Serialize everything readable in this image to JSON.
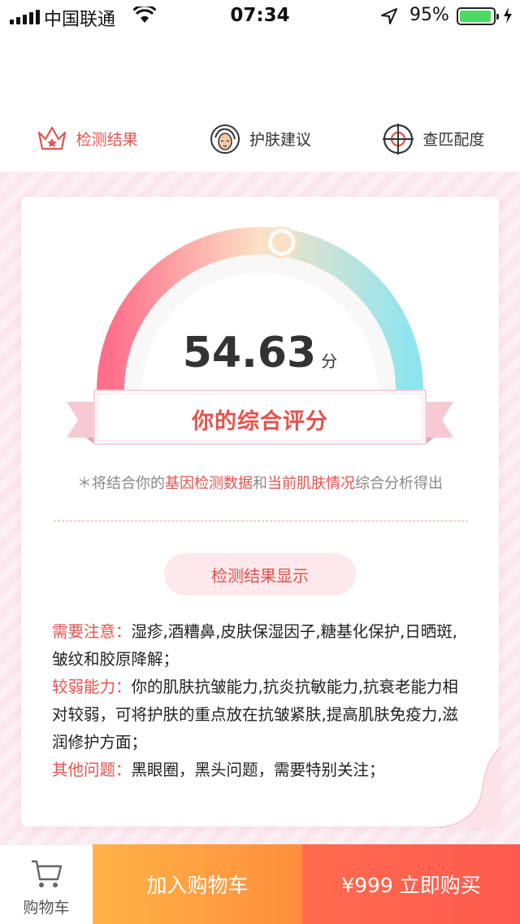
{
  "status_bar": {
    "carrier": "中国联通",
    "time": "07:34",
    "battery": "95%",
    "battery_level": 0.95
  },
  "tabs": [
    {
      "label": "检测结果",
      "icon": "crown-icon",
      "active": true
    },
    {
      "label": "护肤建议",
      "icon": "face-icon",
      "active": false
    },
    {
      "label": "查匹配度",
      "icon": "target-icon",
      "active": false
    }
  ],
  "result": {
    "score": "54.63",
    "score_value": 54.63,
    "score_unit": "分",
    "ribbon_label": "你的综合评分",
    "note_prefix": "＊将结合你的",
    "note_hl1": "基因检测数据",
    "note_mid": "和",
    "note_hl2": "当前肌肤情况",
    "note_suffix": "综合分析得出",
    "section_title": "检测结果显示",
    "items": [
      {
        "label": "需要注意：",
        "text": "湿疹,酒糟鼻,皮肤保湿因子,糖基化保护,日晒斑,皱纹和胶原降解；"
      },
      {
        "label": "较弱能力：",
        "text": "你的肌肤抗皱能力,抗炎抗敏能力,抗衰老能力相对较弱，可将护肤的重点放在抗皱紧肤,提高肌肤免疫力,滋润修护方面；"
      },
      {
        "label": "其他问题：",
        "text": "黑眼圈，黑头问题，需要特别关注；"
      }
    ]
  },
  "bottom_bar": {
    "cart_label": "购物车",
    "add_to_cart": "加入购物车",
    "buy_now": "¥999 立即购买"
  },
  "colors": {
    "accent": "#e4534d",
    "add_button": "#ff9f40",
    "buy_button": "#ff5f4e"
  }
}
